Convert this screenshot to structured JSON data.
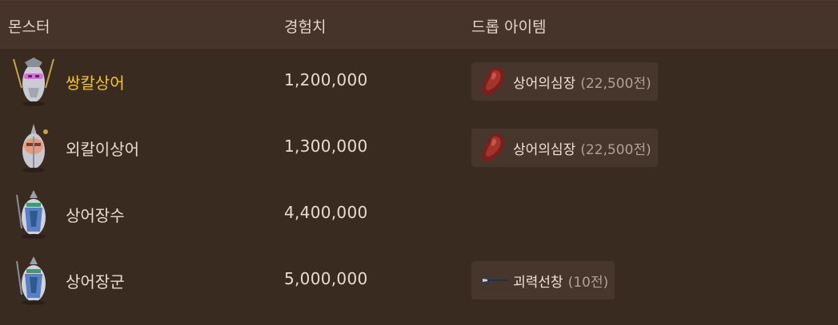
{
  "header": {
    "col_monster": "몬스터",
    "col_exp": "경험치",
    "col_drops": "드롭 아이템"
  },
  "colors": {
    "background": "#3a2b21",
    "header_bg": "#46332a",
    "chip_bg": "#47362b",
    "highlight": "#f3c322",
    "text": "#e6dccf",
    "price": "#b0a294"
  },
  "rows": [
    {
      "name": "쌍칼상어",
      "exp": "1,200,000",
      "icon": "shark-monster-icon",
      "highlight": true,
      "drop": {
        "name": "상어의심장",
        "price": "(22,500전)",
        "icon": "shark-heart-icon"
      }
    },
    {
      "name": "외칼이상어",
      "exp": "1,300,000",
      "icon": "shark-monster-icon",
      "drop": {
        "name": "상어의심장",
        "price": "(22,500전)",
        "icon": "shark-heart-icon"
      }
    },
    {
      "name": "상어장수",
      "exp": "4,400,000",
      "icon": "shark-general-icon"
    },
    {
      "name": "상어장군",
      "exp": "5,000,000",
      "icon": "shark-general-icon",
      "drop": {
        "name": "괴력선창",
        "price": "(10전)",
        "icon": "spear-icon"
      }
    }
  ]
}
